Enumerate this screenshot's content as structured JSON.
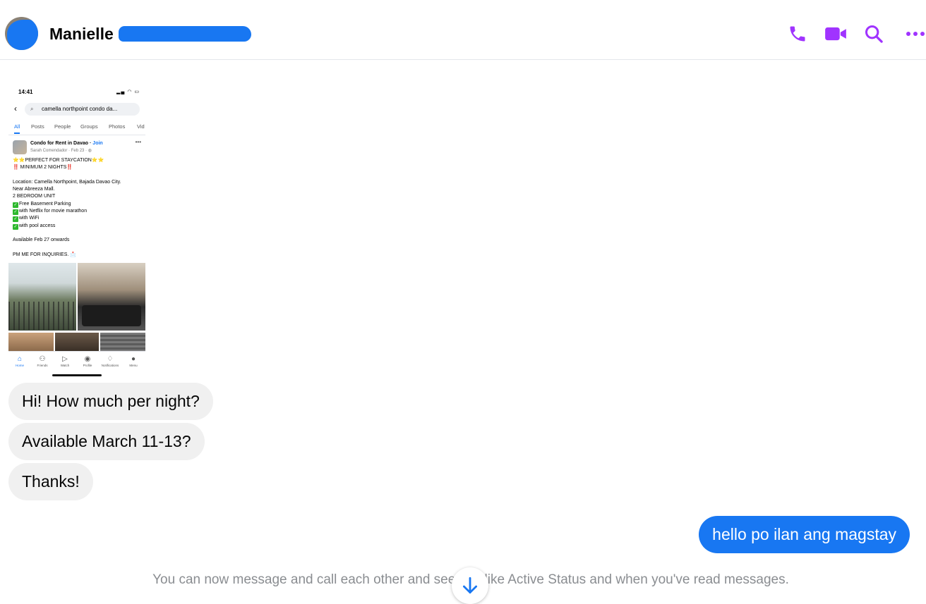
{
  "header": {
    "contact_name": "Manielle",
    "actions": [
      {
        "icon": "phone-icon",
        "label": "Start a voice call"
      },
      {
        "icon": "video-camera-icon",
        "label": "Start a video call"
      },
      {
        "icon": "search-icon",
        "label": "Search in conversation"
      },
      {
        "icon": "more-options-icon",
        "label": "More options"
      }
    ],
    "accent_color": "#a033ff"
  },
  "shared_screenshot": {
    "time": "14:41",
    "search_query": "camella northpoint condo da...",
    "tabs": [
      "All",
      "Posts",
      "People",
      "Groups",
      "Photos",
      "Vid"
    ],
    "active_tab": "All",
    "post": {
      "group": "Condo for Rent in Davao",
      "join": "Join",
      "author_line": "Sarah Comendador · Feb 23 · ",
      "lines": [
        "PERFECT FOR STAYCATION",
        "MINIMUM 2 NIGHTS",
        "Location: Camella Northpoint, Bajada Davao City.",
        "Near Abreeza Mall.",
        "2 BEDROOM  UNIT",
        "Free Basement Parking",
        "with Netflix for movie marathon",
        "with WiFi",
        "with pool access",
        "Available Feb 27 onwards",
        "PM ME FOR INQUIRIES."
      ]
    },
    "nav": [
      "Home",
      "Friends",
      "Watch",
      "Profile",
      "Notifications",
      "Menu"
    ]
  },
  "messages": [
    {
      "direction": "incoming",
      "text": "Hi! How much per night?"
    },
    {
      "direction": "incoming",
      "text": "Available March 11-13?"
    },
    {
      "direction": "incoming",
      "text": "Thanks!"
    },
    {
      "direction": "outgoing",
      "text": "hello po ilan ang magstay"
    }
  ],
  "system_note": "You can now message and call each other and see info like Active Status and when you've read messages.",
  "colors": {
    "outgoing_bubble": "#1877f2",
    "incoming_bubble": "#f0f0f0",
    "header_icons": "#a033ff"
  }
}
